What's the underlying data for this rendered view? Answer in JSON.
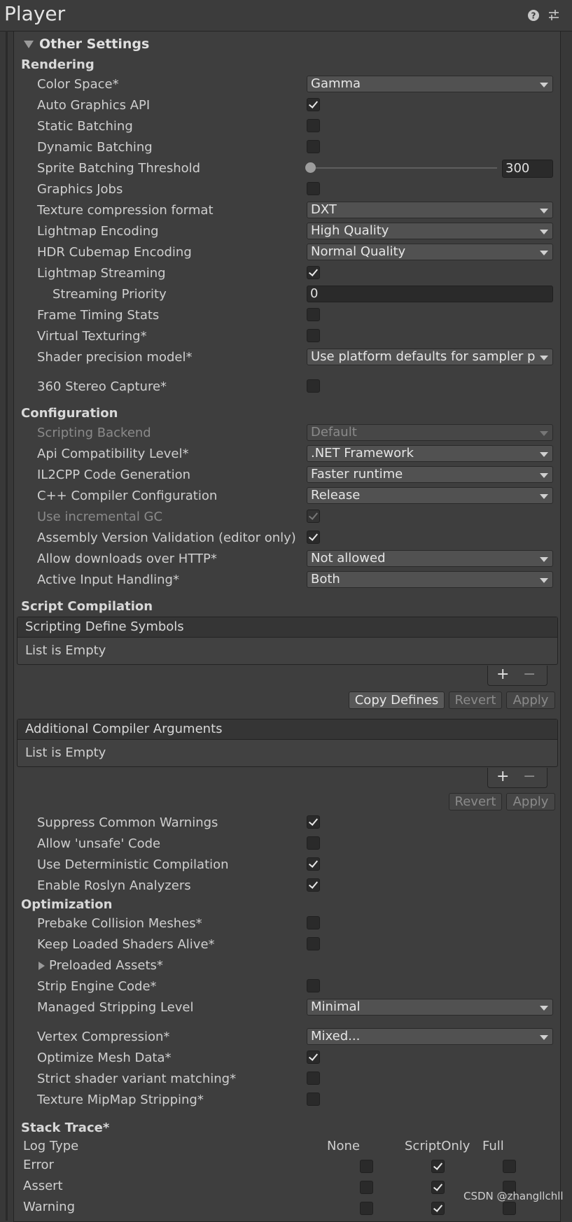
{
  "window": {
    "title": "Player"
  },
  "foldout": {
    "label": "Other Settings"
  },
  "sections": {
    "rendering": "Rendering",
    "configuration": "Configuration",
    "script_compilation": "Script Compilation",
    "optimization": "Optimization",
    "stack_trace": "Stack Trace*"
  },
  "rendering": {
    "color_space": {
      "label": "Color Space*",
      "value": "Gamma"
    },
    "auto_graphics_api": {
      "label": "Auto Graphics API"
    },
    "static_batching": {
      "label": "Static Batching"
    },
    "dynamic_batching": {
      "label": "Dynamic Batching"
    },
    "sprite_batching": {
      "label": "Sprite Batching Threshold",
      "value": "300",
      "slider_fraction": 0.0
    },
    "graphics_jobs": {
      "label": "Graphics Jobs"
    },
    "texture_compression": {
      "label": "Texture compression format",
      "value": "DXT"
    },
    "lightmap_encoding": {
      "label": "Lightmap Encoding",
      "value": "High Quality"
    },
    "hdr_cubemap": {
      "label": "HDR Cubemap Encoding",
      "value": "Normal Quality"
    },
    "lightmap_streaming": {
      "label": "Lightmap Streaming"
    },
    "streaming_priority": {
      "label": "Streaming Priority",
      "value": "0"
    },
    "frame_timing": {
      "label": "Frame Timing Stats"
    },
    "virtual_texturing": {
      "label": "Virtual Texturing*"
    },
    "shader_precision": {
      "label": "Shader precision model*",
      "value": "Use platform defaults for sampler precision"
    },
    "stereo_capture": {
      "label": "360 Stereo Capture*"
    }
  },
  "configuration": {
    "scripting_backend": {
      "label": "Scripting Backend",
      "value": "Default"
    },
    "api_compat": {
      "label": "Api Compatibility Level*",
      "value": ".NET Framework"
    },
    "il2cpp_codegen": {
      "label": "IL2CPP Code Generation",
      "value": "Faster runtime"
    },
    "cpp_compiler": {
      "label": "C++ Compiler Configuration",
      "value": "Release"
    },
    "incremental_gc": {
      "label": "Use incremental GC"
    },
    "assembly_validation": {
      "label": "Assembly Version Validation (editor only)"
    },
    "http_downloads": {
      "label": "Allow downloads over HTTP*",
      "value": "Not allowed"
    },
    "input_handling": {
      "label": "Active Input Handling*",
      "value": "Both"
    }
  },
  "script_compilation": {
    "define_symbols": {
      "header": "Scripting Define Symbols",
      "empty": "List is Empty"
    },
    "compiler_args": {
      "header": "Additional Compiler Arguments",
      "empty": "List is Empty"
    },
    "plus": "+",
    "minus": "−",
    "copy_defines": "Copy Defines",
    "revert": "Revert",
    "apply": "Apply",
    "suppress_warnings": {
      "label": "Suppress Common Warnings"
    },
    "unsafe_code": {
      "label": "Allow 'unsafe' Code"
    },
    "deterministic": {
      "label": "Use Deterministic Compilation"
    },
    "roslyn": {
      "label": "Enable Roslyn Analyzers"
    }
  },
  "optimization": {
    "prebake": {
      "label": "Prebake Collision Meshes*"
    },
    "keep_shaders": {
      "label": "Keep Loaded Shaders Alive*"
    },
    "preloaded_assets": {
      "label": "Preloaded Assets*"
    },
    "strip_engine": {
      "label": "Strip Engine Code*"
    },
    "managed_stripping": {
      "label": "Managed Stripping Level",
      "value": "Minimal"
    },
    "vertex_compression": {
      "label": "Vertex Compression*",
      "value": "Mixed..."
    },
    "optimize_mesh": {
      "label": "Optimize Mesh Data*"
    },
    "strict_shader": {
      "label": "Strict shader variant matching*"
    },
    "mipmap_stripping": {
      "label": "Texture MipMap Stripping*"
    }
  },
  "stack_trace": {
    "columns": [
      "Log Type",
      "None",
      "ScriptOnly",
      "Full"
    ],
    "rows": [
      {
        "type": "Error",
        "none": false,
        "script_only": true,
        "full": false
      },
      {
        "type": "Assert",
        "none": false,
        "script_only": true,
        "full": false
      },
      {
        "type": "Warning",
        "none": false,
        "script_only": true,
        "full": false
      }
    ]
  },
  "watermark": "CSDN @zhangllchll"
}
